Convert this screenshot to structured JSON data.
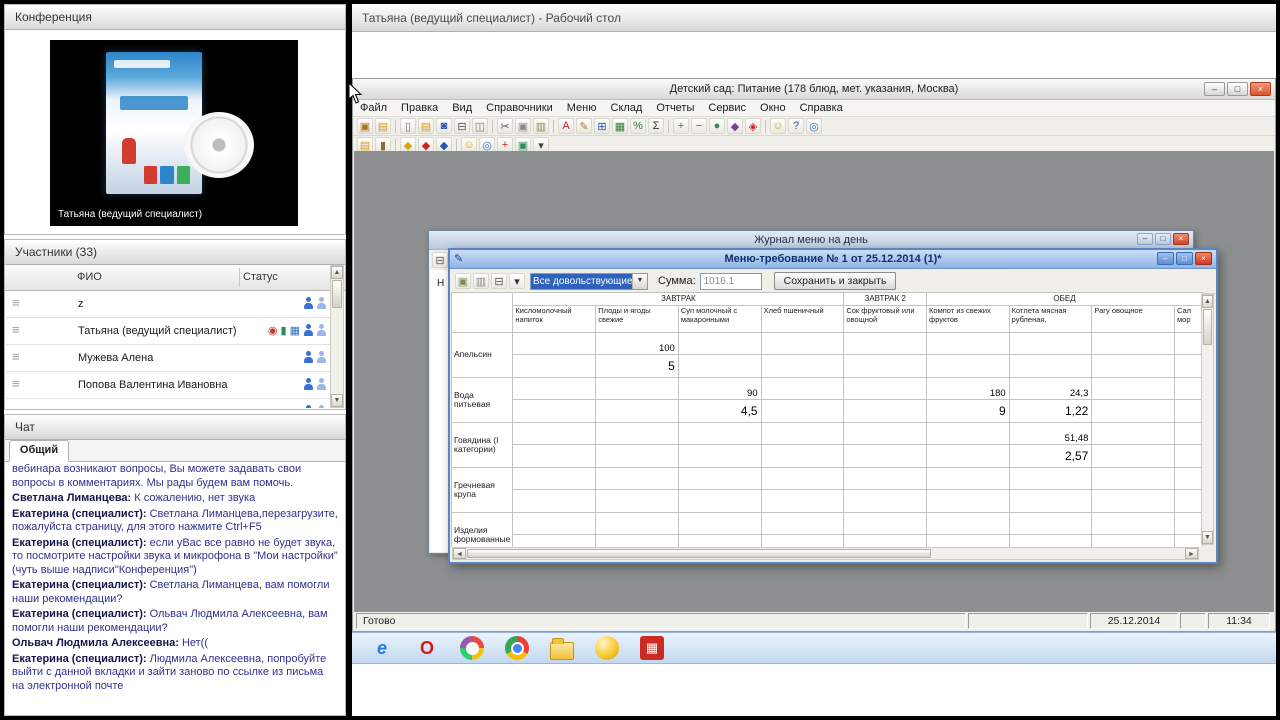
{
  "glyphs": {
    "min": "–",
    "max": "□",
    "close": "×",
    "up": "▲",
    "down": "▼",
    "left": "◄",
    "right": "►",
    "grip": "≡",
    "combo": "▼",
    "pencil": "✎"
  },
  "conference": {
    "title": "Конференция",
    "video_caption": "Татьяна (ведущий специалист)"
  },
  "participants": {
    "title": "Участники (33)",
    "columns": {
      "name": "ФИО",
      "status": "Статус"
    },
    "rows": [
      {
        "name": "z",
        "media": []
      },
      {
        "name": "Татьяна (ведущий специалист)",
        "media": [
          "camera",
          "chart",
          "screen"
        ]
      },
      {
        "name": "Мужева Алена",
        "media": []
      },
      {
        "name": "Попова Валентина  Ивановна",
        "media": []
      },
      {
        "name": "",
        "media": []
      }
    ]
  },
  "chat": {
    "title": "Чат",
    "tab": "Общий",
    "messages": [
      {
        "name": "",
        "text": "вебинара возникают вопросы, Вы можете задавать свои вопросы в комментариях. Мы рады будем вам помочь."
      },
      {
        "name": "Светлана Лиманцева:",
        "text": "К сожалению, нет звука"
      },
      {
        "name": "Екатерина (специалист):",
        "text": "Светлана Лиманцева,перезагрузите, пожалуйста страницу, для этого нажмите Ctrl+F5"
      },
      {
        "name": "Екатерина (специалист):",
        "text": "если уВас все равно не будет звука, то посмотрите настройки звука и микрофона в \"Мои настройки\" (чуть выше надписи\"Конференция\")"
      },
      {
        "name": "Екатерина (специалист):",
        "text": "Светлана Лиманцева, вам помогли наши рекомендации?"
      },
      {
        "name": "Екатерина (специалист):",
        "text": "Ольвач Людмила Алексеевна, вам помогли наши рекомендации?"
      },
      {
        "name": "Ольвач Людмила  Алексеевна:",
        "text": "Нет(("
      },
      {
        "name": "Екатерина (специалист):",
        "text": "Людмила  Алексеевна, попробуйте выйти с данной вкладки и зайти заново по ссылке из письма на электронной почте"
      }
    ]
  },
  "main_header": "Татьяна (ведущий специалист) - Рабочий стол",
  "app": {
    "title": "Детский сад: Питание (178 блюд, мет. указания, Москва)",
    "menu": [
      "Файл",
      "Правка",
      "Вид",
      "Справочники",
      "Меню",
      "Склад",
      "Отчеты",
      "Сервис",
      "Окно",
      "Справка"
    ],
    "toolbar1": [
      {
        "n": "briefcase",
        "g": "▣",
        "c": "#a87416"
      },
      {
        "n": "folder",
        "g": "▤",
        "c": "#d79c1e"
      },
      {
        "sep": true
      },
      {
        "n": "new-doc",
        "g": "▯",
        "c": "#777777"
      },
      {
        "n": "open",
        "g": "▤",
        "c": "#d79c1e"
      },
      {
        "n": "save",
        "g": "◙",
        "c": "#2456b0"
      },
      {
        "n": "print",
        "g": "⊟",
        "c": "#555555"
      },
      {
        "n": "preview",
        "g": "◫",
        "c": "#777777"
      },
      {
        "sep": true
      },
      {
        "n": "cut",
        "g": "✂",
        "c": "#555555"
      },
      {
        "n": "copy",
        "g": "▣",
        "c": "#888888"
      },
      {
        "n": "paste",
        "g": "▥",
        "c": "#99884f"
      },
      {
        "sep": true
      },
      {
        "n": "font",
        "g": "А",
        "c": "#cc2222"
      },
      {
        "n": "edit",
        "g": "✎",
        "c": "#b8741a"
      },
      {
        "n": "table",
        "g": "⊞",
        "c": "#2456b0"
      },
      {
        "n": "grid",
        "g": "▦",
        "c": "#2e7d32"
      },
      {
        "n": "percent",
        "g": "%",
        "c": "#2e7d32"
      },
      {
        "n": "sum",
        "g": "Σ",
        "c": "#333333"
      },
      {
        "sep": true
      },
      {
        "n": "add",
        "g": "+",
        "c": "#2e8b22"
      },
      {
        "n": "remove",
        "g": "−",
        "c": "#cc2222"
      },
      {
        "n": "ok",
        "g": "●",
        "c": "#2e8b57"
      },
      {
        "n": "module",
        "g": "◆",
        "c": "#7b3fa0"
      },
      {
        "n": "mark",
        "g": "◈",
        "c": "#cc2222"
      },
      {
        "sep": true
      },
      {
        "n": "smile",
        "g": "☺",
        "c": "#d7a800"
      },
      {
        "n": "help",
        "g": "?",
        "c": "#2456b0"
      },
      {
        "n": "web",
        "g": "◎",
        "c": "#2e76c9"
      }
    ],
    "toolbar2": [
      {
        "n": "folder2",
        "g": "▤",
        "c": "#d79c1e"
      },
      {
        "n": "lock",
        "g": "▮",
        "c": "#8a6d3b"
      },
      {
        "sep": true
      },
      {
        "n": "key-yellow",
        "g": "◆",
        "c": "#d7a800"
      },
      {
        "n": "key-red",
        "g": "◆",
        "c": "#cc2222"
      },
      {
        "n": "key-blue",
        "g": "◆",
        "c": "#2456b0"
      },
      {
        "sep": true
      },
      {
        "n": "smiley",
        "g": "☺",
        "c": "#d7a800"
      },
      {
        "n": "globe",
        "g": "◎",
        "c": "#2e76c9"
      },
      {
        "n": "plus-red",
        "g": "+",
        "c": "#cc2222"
      },
      {
        "n": "box-green",
        "g": "▣",
        "c": "#2e8b57"
      },
      {
        "n": "more",
        "g": "▾",
        "c": "#444444"
      }
    ],
    "status": {
      "ready": "Готово",
      "date": "25.12.2014",
      "time": "11:34"
    }
  },
  "journal": {
    "title": "Журнал меню на день",
    "partial_text": "Н",
    "tool_icons": [
      {
        "n": "print",
        "g": "⊟",
        "c": "#555555"
      },
      {
        "n": "folder",
        "g": "▤",
        "c": "#d79c1e"
      }
    ]
  },
  "dialog": {
    "title": "Меню-требование № 1 от 25.12.2014 (1)*",
    "tool_icons": [
      {
        "n": "save",
        "g": "▣",
        "c": "#7a8f5a"
      },
      {
        "n": "copy",
        "g": "▥",
        "c": "#888888"
      },
      {
        "n": "print",
        "g": "⊟",
        "c": "#555555"
      },
      {
        "n": "dropdown-arrow",
        "g": "▾",
        "c": "#333333"
      }
    ],
    "combo_value": "Все довольствующиеся",
    "sum_label": "Сумма:",
    "sum_value": "1016.1",
    "save_button": "Сохранить и закрыть",
    "groups": [
      "ЗАВТРАК",
      "ЗАВТРАК 2",
      "ОБЕД"
    ],
    "columns": [
      "Кисломолочный напиток",
      "Плоды и ягоды свежие",
      "Суп молочный с макаронными",
      "Хлеб пшеничный",
      "Сок фруктовый или овощной",
      "Компот из свежих фруктов",
      "Котлета мясная рубленая,",
      "Рагу овощное",
      "Сал мор"
    ],
    "rows": [
      {
        "label": "Апельсин",
        "values": {
          "1": [
            "100",
            "5"
          ]
        }
      },
      {
        "label": "Вода питьевая",
        "values": {
          "2": [
            "90",
            "4,5"
          ],
          "5": [
            "180",
            "9"
          ],
          "6": [
            "24,3",
            "1,22"
          ]
        }
      },
      {
        "label": "Говядина (I категории)",
        "values": {
          "6": [
            "51,48",
            "2,57"
          ]
        }
      },
      {
        "label": "Гречневая крупа",
        "values": {}
      },
      {
        "label": "Изделия формованные",
        "values": {}
      }
    ]
  },
  "taskbar": [
    {
      "name": "internet-explorer",
      "type": "glyph",
      "glyph": "e",
      "color": "#2a7de1",
      "italic": true
    },
    {
      "name": "opera",
      "type": "glyph",
      "glyph": "O",
      "color": "#d6191f"
    },
    {
      "name": "palette",
      "type": "wheel",
      "colors": [
        "#e74c3c",
        "#f1c40f",
        "#2ecc71",
        "#9b59b6"
      ],
      "center": "#ffffff"
    },
    {
      "name": "chrome",
      "type": "wheel",
      "colors": [
        "#ea4335",
        "#fbbc05",
        "#34a853"
      ],
      "center": "#4285f4"
    },
    {
      "name": "folder",
      "type": "folder",
      "color": "#f3c13a"
    },
    {
      "name": "yellow-ball",
      "type": "ball",
      "color": "#f5c623"
    },
    {
      "name": "red-app",
      "type": "tile",
      "glyph": "▦",
      "color": "#ffffff",
      "bg": "#cc2b24"
    }
  ]
}
